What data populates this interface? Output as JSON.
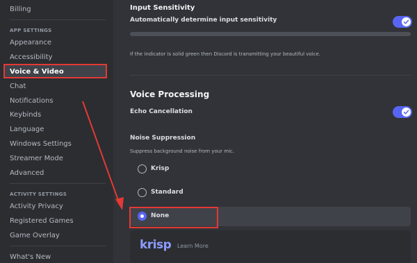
{
  "sidebar": {
    "billing": "Billing",
    "app_settings_header": "APP SETTINGS",
    "items": [
      "Appearance",
      "Accessibility",
      "Voice & Video",
      "Chat",
      "Notifications",
      "Keybinds",
      "Language",
      "Windows Settings",
      "Streamer Mode",
      "Advanced"
    ],
    "activity_settings_header": "ACTIVITY SETTINGS",
    "activity_items": [
      "Activity Privacy",
      "Registered Games",
      "Game Overlay"
    ],
    "whats_new": "What's New"
  },
  "main": {
    "input_sensitivity": {
      "title": "Input Sensitivity",
      "auto_label": "Automatically determine input sensitivity",
      "auto_enabled": true,
      "help": "If the indicator is solid green then Discord is transmitting your beautiful voice."
    },
    "voice_processing": {
      "title": "Voice Processing",
      "echo_label": "Echo Cancellation",
      "echo_enabled": true,
      "noise_title": "Noise Suppression",
      "noise_desc": "Suppress background noise from your mic.",
      "options": [
        "Krisp",
        "Standard",
        "None"
      ],
      "selected": "None"
    },
    "krisp": {
      "logo": "krisp",
      "learn_more": "Learn More"
    }
  },
  "colors": {
    "accent": "#5865f2",
    "highlight": "#e53935",
    "sidebar_bg": "#2b2d31",
    "main_bg": "#313338"
  }
}
